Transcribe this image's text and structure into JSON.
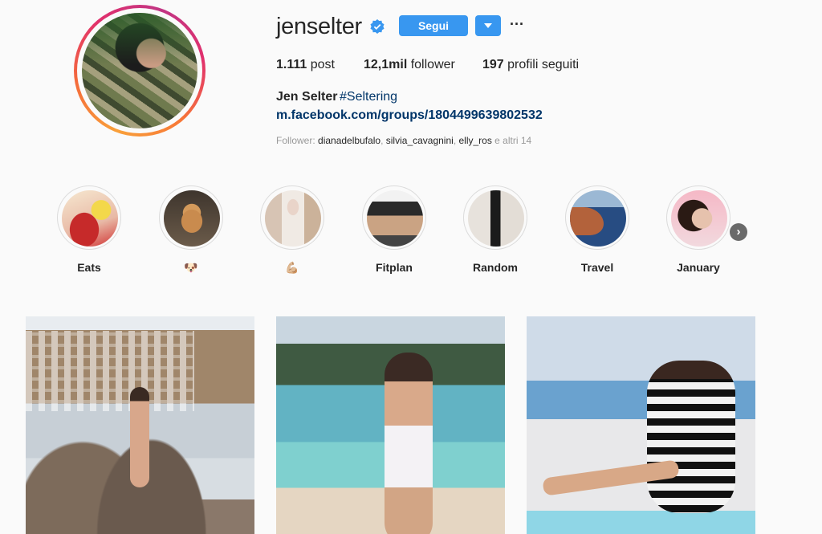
{
  "profile": {
    "username": "jenselter",
    "verified": true,
    "follow_label": "Segui",
    "more_label": "···",
    "stats": {
      "posts_count": "1.111",
      "posts_label": " post",
      "followers_count": "12,1mil",
      "followers_label": " follower",
      "following_count": "197",
      "following_label": " profili seguiti"
    },
    "bio": {
      "full_name": "Jen Selter",
      "hashtag": "#Seltering",
      "link": "m.facebook.com/groups/1804499639802532"
    },
    "followed_by": {
      "prefix": "Follower: ",
      "users": [
        "dianadelbufalo",
        "silvia_cavagnini",
        "elly_ros"
      ],
      "separator": ", ",
      "suffix": " e altri 14"
    }
  },
  "highlights": [
    {
      "label": "Eats"
    },
    {
      "label": "🐶"
    },
    {
      "label": "💪🏼"
    },
    {
      "label": "Fitplan"
    },
    {
      "label": "Random"
    },
    {
      "label": "Travel"
    },
    {
      "label": "January"
    }
  ],
  "highlights_next_icon": "chevron-right-icon",
  "colors": {
    "accent": "#3897f0",
    "link": "#003569",
    "text": "#262626",
    "muted": "#999999",
    "background": "#fafafa"
  }
}
